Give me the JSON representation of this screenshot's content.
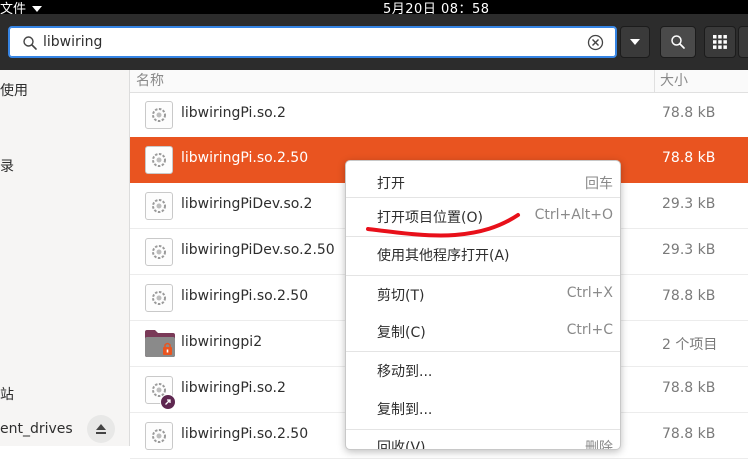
{
  "topbar": {
    "app_menu": "文件",
    "clock": "5月20日  08：58"
  },
  "search": {
    "value": "libwiring"
  },
  "sidebar": {
    "items": [
      {
        "label": "使用"
      },
      {
        "label": "录"
      },
      {
        "label": "站"
      },
      {
        "label": "ent_drives"
      }
    ]
  },
  "columns": {
    "name": "名称",
    "size": "大小"
  },
  "files": [
    {
      "name": "libwiringPi.so.2",
      "size": "78.8 kB",
      "icon": "shared-library-icon"
    },
    {
      "name": "libwiringPi.so.2.50",
      "size": "78.8 kB",
      "icon": "shared-library-icon",
      "selected": true
    },
    {
      "name": "libwiringPiDev.so.2",
      "size": "29.3 kB",
      "icon": "shared-library-icon"
    },
    {
      "name": "libwiringPiDev.so.2.50",
      "size": "29.3 kB",
      "icon": "shared-library-icon"
    },
    {
      "name": "libwiringPi.so.2.50",
      "size": "78.8 kB",
      "icon": "shared-library-icon"
    },
    {
      "name": "libwiringpi2",
      "size": "2 个项目",
      "icon": "locked-folder-icon"
    },
    {
      "name": "libwiringPi.so.2",
      "size": "78.8 kB",
      "icon": "symlink-library-icon"
    },
    {
      "name": "libwiringPi.so.2.50",
      "size": "78.8 kB",
      "icon": "shared-library-icon"
    }
  ],
  "context_menu": {
    "items": [
      {
        "label": "打开",
        "accel": "回车"
      },
      {
        "label": "打开项目位置(O)",
        "accel": "Ctrl+Alt+O"
      },
      {
        "label": "使用其他程序打开(A)",
        "accel": ""
      },
      {
        "label": "剪切(T)",
        "accel": "Ctrl+X"
      },
      {
        "label": "复制(C)",
        "accel": "Ctrl+C"
      },
      {
        "label": "移动到...",
        "accel": ""
      },
      {
        "label": "复制到...",
        "accel": ""
      },
      {
        "label": "回收(V)",
        "accel": "删除"
      }
    ]
  },
  "colors": {
    "accent": "#e95420",
    "header": "#2c2c2c",
    "annotation": "#e8101a",
    "focus": "#3584e4"
  }
}
